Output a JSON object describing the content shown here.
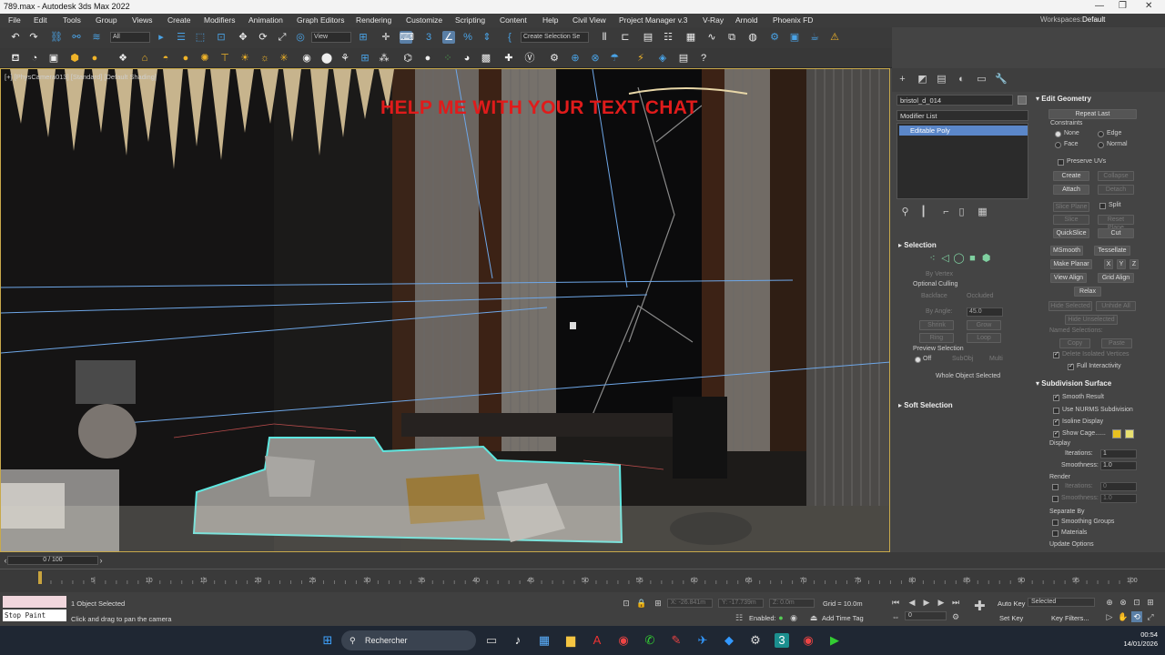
{
  "window": {
    "title": "789.max - Autodesk 3ds Max 2022"
  },
  "menu": [
    "File",
    "Edit",
    "Tools",
    "Group",
    "Views",
    "Create",
    "Modifiers",
    "Animation",
    "Graph Editors",
    "Rendering",
    "Customize",
    "Scripting",
    "Content",
    "Help",
    "Civil View",
    "Project Manager v.3",
    "V-Ray",
    "Arnold",
    "Phoenix FD"
  ],
  "workspaces": {
    "label": "Workspaces:",
    "value": "Default"
  },
  "toolbar": {
    "filter": "All",
    "refcoord": "View",
    "selset": "Create Selection Se"
  },
  "viewport": {
    "label": "[+] [PhysCamera013] [Standard] [Default Shading]",
    "overlay_text": "HELP ME WITH YOUR TEXT CHAT"
  },
  "command_panel": {
    "object_name": "bristol_d_014",
    "modifier_list": "Modifier List",
    "stack_item": "Editable Poly",
    "selection": {
      "title": "Selection",
      "by_vertex": "By Vertex",
      "optional_culling": "Optional Culling",
      "backface": "Backface",
      "occluded": "Occluded",
      "by_angle": "By Angle:",
      "by_angle_value": "45.0",
      "shrink": "Shrink",
      "grow": "Grow",
      "ring": "Ring",
      "loop": "Loop",
      "preview_selection": "Preview Selection",
      "off": "Off",
      "subobj": "SubObj",
      "multi": "Multi",
      "status": "Whole Object Selected"
    },
    "soft_selection": "Soft Selection",
    "edit_geometry": {
      "title": "Edit Geometry",
      "repeat_last": "Repeat Last",
      "constraints": "Constraints",
      "none": "None",
      "edge": "Edge",
      "face": "Face",
      "normal": "Normal",
      "preserve_uvs": "Preserve UVs",
      "create": "Create",
      "collapse": "Collapse",
      "attach": "Attach",
      "detach": "Detach",
      "slice_plane": "Slice Plane",
      "split": "Split",
      "slice": "Slice",
      "reset_plane": "Reset Plane",
      "quickslice": "QuickSlice",
      "cut": "Cut",
      "msmooth": "MSmooth",
      "tessellate": "Tessellate",
      "make_planar": "Make Planar",
      "x": "X",
      "y": "Y",
      "z": "Z",
      "view_align": "View Align",
      "grid_align": "Grid Align",
      "relax": "Relax",
      "hide_selected": "Hide Selected",
      "unhide_all": "Unhide All",
      "hide_unselected": "Hide Unselected",
      "named_selections": "Named Selections:",
      "copy": "Copy",
      "paste": "Paste",
      "delete_isolated": "Delete Isolated Vertices",
      "full_interactivity": "Full Interactivity"
    },
    "subdivision": {
      "title": "Subdivision Surface",
      "smooth_result": "Smooth Result",
      "use_nurms": "Use NURMS Subdivision",
      "isoline_display": "Isoline Display",
      "show_cage": "Show Cage......",
      "display": "Display",
      "iterations": "Iterations:",
      "iterations_value": "1",
      "smoothness": "Smoothness:",
      "smoothness_value": "1.0",
      "render": "Render",
      "render_iterations_value": "0",
      "render_smoothness_value": "1.0",
      "separate_by": "Separate By",
      "smoothing_groups": "Smoothing Groups",
      "materials": "Materials",
      "update_options": "Update Options"
    }
  },
  "timeline": {
    "frame": "0 / 100",
    "ticks": [
      "0",
      "5",
      "10",
      "15",
      "20",
      "25",
      "30",
      "35",
      "40",
      "45",
      "50",
      "55",
      "60",
      "65",
      "70",
      "75",
      "80",
      "85",
      "90",
      "95",
      "100"
    ]
  },
  "status": {
    "selected": "1 Object Selected",
    "prompt": "Click and drag to pan the camera",
    "maxscript": "Stop Paint",
    "x": "X: -26.841m",
    "y": "Y: -17.739m",
    "z": "Z: 0.0m",
    "grid": "Grid = 10.0m",
    "enabled": "Enabled:",
    "add_time_tag": "Add Time Tag",
    "auto_key": "Auto Key",
    "set_key": "Set Key",
    "selected_dd": "Selected",
    "key_filters": "Key Filters...",
    "frame_value": "0"
  },
  "taskbar": {
    "search": "Rechercher",
    "time": "00:54",
    "date": "14/01/2026"
  }
}
